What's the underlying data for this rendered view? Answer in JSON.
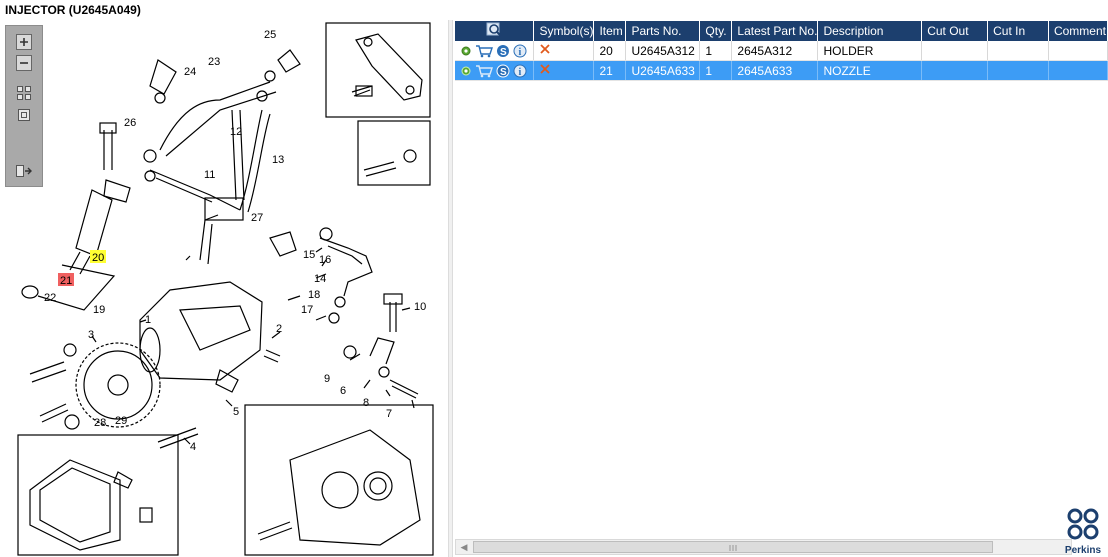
{
  "window": {
    "title": "INJECTOR (U2645A049)"
  },
  "diagram": {
    "callouts": [
      "1",
      "2",
      "3",
      "4",
      "5",
      "6",
      "7",
      "8",
      "9",
      "10",
      "11",
      "12",
      "13",
      "14",
      "15",
      "16",
      "17",
      "18",
      "19",
      "20",
      "21",
      "22",
      "23",
      "24",
      "25",
      "26",
      "27",
      "28",
      "29"
    ],
    "highlight_colors": {
      "item20": "#ffff33",
      "item21": "#f06060"
    }
  },
  "table": {
    "columns": [
      "",
      "Symbol(s)",
      "Item",
      "Parts No.",
      "Qty.",
      "Latest Part No.",
      "Description",
      "Cut Out",
      "Cut In",
      "Comment"
    ],
    "rows": [
      {
        "item": "20",
        "parts_no": "U2645A312",
        "qty": "1",
        "latest_part_no": "2645A312",
        "description": "HOLDER",
        "cut_out": "",
        "cut_in": "",
        "comment": "",
        "selected": false
      },
      {
        "item": "21",
        "parts_no": "U2645A633",
        "qty": "1",
        "latest_part_no": "2645A633",
        "description": "NOZZLE",
        "cut_out": "",
        "cut_in": "",
        "comment": "",
        "selected": true
      }
    ],
    "symbol_icons": [
      "gear-icon",
      "cart-icon",
      "service-icon",
      "info-icon"
    ],
    "header_color": "#1c3f6e",
    "selected_color": "#3d9cf5"
  },
  "brand": {
    "name": "Perkins"
  }
}
